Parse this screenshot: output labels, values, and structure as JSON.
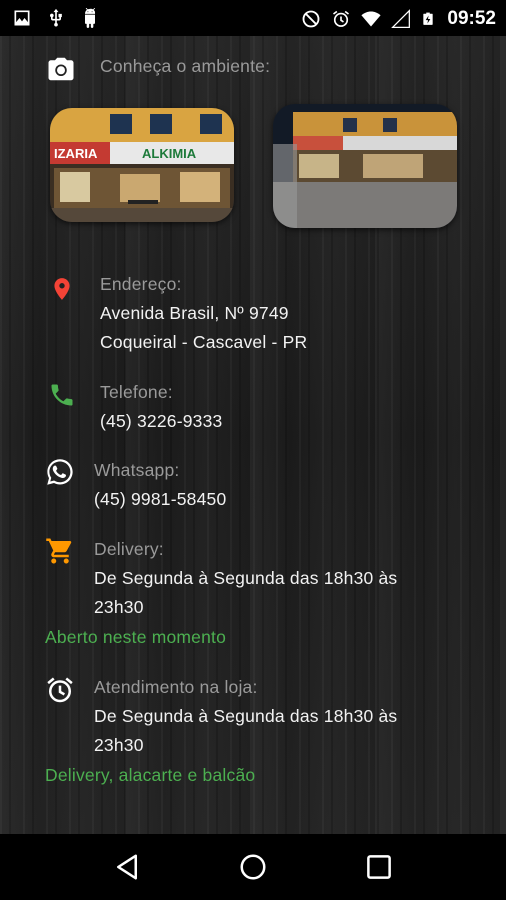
{
  "status_bar": {
    "time": "09:52"
  },
  "ambiente": {
    "label": "Conheça o ambiente:",
    "photo1_sign": "ALKIMIA",
    "photo1_sign2": "IZARIA"
  },
  "endereco": {
    "label": "Endereço:",
    "line1": "Avenida Brasil, Nº 9749",
    "line2": "Coqueiral - Cascavel - PR"
  },
  "telefone": {
    "label": "Telefone:",
    "value": "(45) 3226-9333"
  },
  "whatsapp": {
    "label": "Whatsapp:",
    "value": "(45) 9981-58450"
  },
  "delivery": {
    "label": "Delivery:",
    "line1": "De Segunda à Segunda das 18h30 às",
    "line2": "23h30",
    "status": "Aberto neste momento"
  },
  "atendimento": {
    "label": "Atendimento na loja:",
    "line1": "De Segunda à Segunda das 18h30 às",
    "line2": "23h30",
    "note": "Delivery, alacarte e balcão"
  },
  "colors": {
    "accent_green": "#4caf50",
    "location_red": "#f44336",
    "phone_green": "#4caf50",
    "cart_orange": "#ff9800"
  }
}
